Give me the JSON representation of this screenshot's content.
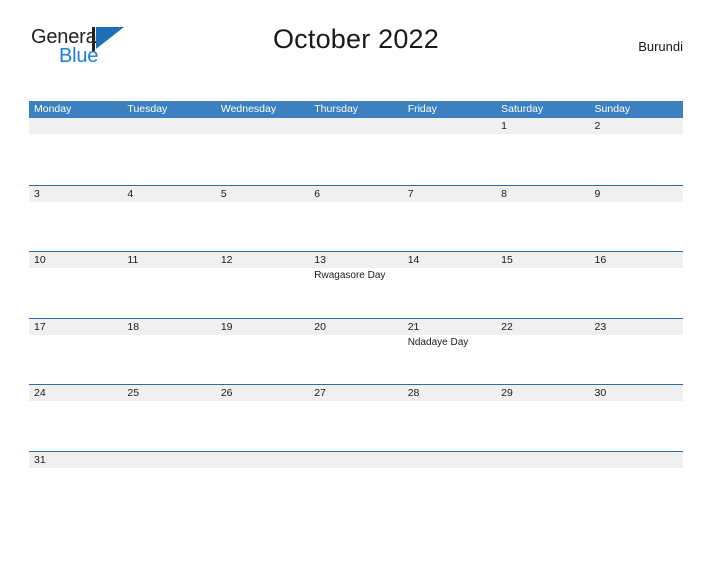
{
  "brand": {
    "name_part1": "General",
    "name_part2": "Blue",
    "mark": "triangle-logo"
  },
  "header": {
    "title": "October 2022",
    "country": "Burundi"
  },
  "colors": {
    "header_blue": "#3d80bf",
    "row_rule_blue": "#2e6da4",
    "band_gray": "#f0f0f0",
    "brand_blue": "#1a7fd4",
    "logo_mark_blue": "#1d6fb8",
    "text": "#1a1a1a"
  },
  "weekdays": [
    "Monday",
    "Tuesday",
    "Wednesday",
    "Thursday",
    "Friday",
    "Saturday",
    "Sunday"
  ],
  "weeks": [
    [
      {
        "day": ""
      },
      {
        "day": ""
      },
      {
        "day": ""
      },
      {
        "day": ""
      },
      {
        "day": ""
      },
      {
        "day": "1"
      },
      {
        "day": "2"
      }
    ],
    [
      {
        "day": "3"
      },
      {
        "day": "4"
      },
      {
        "day": "5"
      },
      {
        "day": "6"
      },
      {
        "day": "7"
      },
      {
        "day": "8"
      },
      {
        "day": "9"
      }
    ],
    [
      {
        "day": "10"
      },
      {
        "day": "11"
      },
      {
        "day": "12"
      },
      {
        "day": "13",
        "event": "Rwagasore Day"
      },
      {
        "day": "14"
      },
      {
        "day": "15"
      },
      {
        "day": "16"
      }
    ],
    [
      {
        "day": "17"
      },
      {
        "day": "18"
      },
      {
        "day": "19"
      },
      {
        "day": "20"
      },
      {
        "day": "21",
        "event": "Ndadaye Day"
      },
      {
        "day": "22"
      },
      {
        "day": "23"
      }
    ],
    [
      {
        "day": "24"
      },
      {
        "day": "25"
      },
      {
        "day": "26"
      },
      {
        "day": "27"
      },
      {
        "day": "28"
      },
      {
        "day": "29"
      },
      {
        "day": "30"
      }
    ],
    [
      {
        "day": "31"
      },
      {
        "day": ""
      },
      {
        "day": ""
      },
      {
        "day": ""
      },
      {
        "day": ""
      },
      {
        "day": ""
      },
      {
        "day": ""
      }
    ]
  ]
}
